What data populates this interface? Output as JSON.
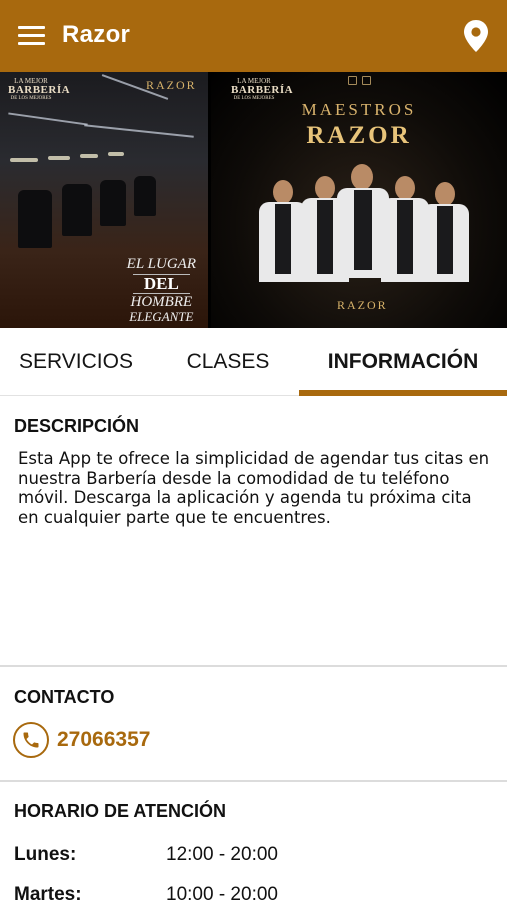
{
  "appbar": {
    "title": "Razor",
    "menu_icon": "hamburger-menu-icon",
    "location_icon": "location-pin-icon",
    "color": "#a8690e"
  },
  "banner": {
    "left_panel": {
      "logo_top": "LA MEJOR",
      "logo_main": "BARBERÍA",
      "logo_sub": "DE LOS MEJORES",
      "brand": "RAZOR",
      "tagline_1": "EL LUGAR",
      "tagline_2": "DEL",
      "tagline_3": "HOMBRE",
      "tagline_4": "ELEGANTE"
    },
    "right_panel": {
      "logo_top": "LA MEJOR",
      "logo_main": "BARBERÍA",
      "logo_sub": "DE LOS MEJORES",
      "headline_1": "MAESTROS",
      "headline_2": "RAZOR",
      "brand": "RAZOR"
    },
    "carousel": {
      "total": 2,
      "active": 1
    }
  },
  "tabs": [
    {
      "label": "SERVICIOS",
      "active": false
    },
    {
      "label": "CLASES",
      "active": false
    },
    {
      "label": "INFORMACIÓN",
      "active": true
    }
  ],
  "descripcion": {
    "title": "DESCRIPCIÓN",
    "text": "Esta App te ofrece la simplicidad de agendar tus citas en nuestra Barbería desde la comodidad de tu teléfono móvil. Descarga la aplicación y agenda tu próxima cita en cualquier parte que te encuentres."
  },
  "contacto": {
    "title": "CONTACTO",
    "phone": "27066357",
    "phone_icon": "phone-icon"
  },
  "horario": {
    "title": "HORARIO DE ATENCIÓN",
    "rows": [
      {
        "day": "Lunes:",
        "hours": "12:00 - 20:00"
      },
      {
        "day": "Martes:",
        "hours": "10:00 - 20:00"
      }
    ]
  }
}
